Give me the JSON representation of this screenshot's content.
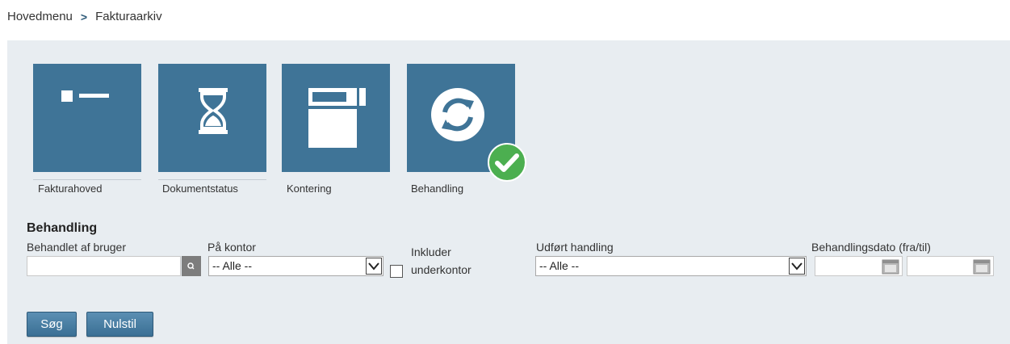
{
  "breadcrumb": {
    "home": "Hovedmenu",
    "separator": ">",
    "current": "Fakturaarkiv"
  },
  "tiles": [
    {
      "label": "Fakturahoved",
      "icon": "header-icon"
    },
    {
      "label": "Dokumentstatus",
      "icon": "hourglass-icon"
    },
    {
      "label": "Kontering",
      "icon": "window-icon"
    },
    {
      "label": "Behandling",
      "icon": "refresh-icon",
      "selected": true
    }
  ],
  "form": {
    "title": "Behandling",
    "user_label": "Behandlet af bruger",
    "user_value": "",
    "office_label": "På kontor",
    "office_selected": "-- Alle --",
    "include_label_1": "Inkluder",
    "include_label_2": "underkontor",
    "action_label": "Udført handling",
    "action_selected": "-- Alle --",
    "date_label": "Behandlingsdato (fra/til)",
    "date_from": "",
    "date_to": ""
  },
  "buttons": {
    "search": "Søg",
    "reset": "Nulstil"
  },
  "colors": {
    "tile": "#3f7497",
    "panel": "#e8edf1",
    "check": "#4caf50",
    "button": "#4a80a6"
  }
}
